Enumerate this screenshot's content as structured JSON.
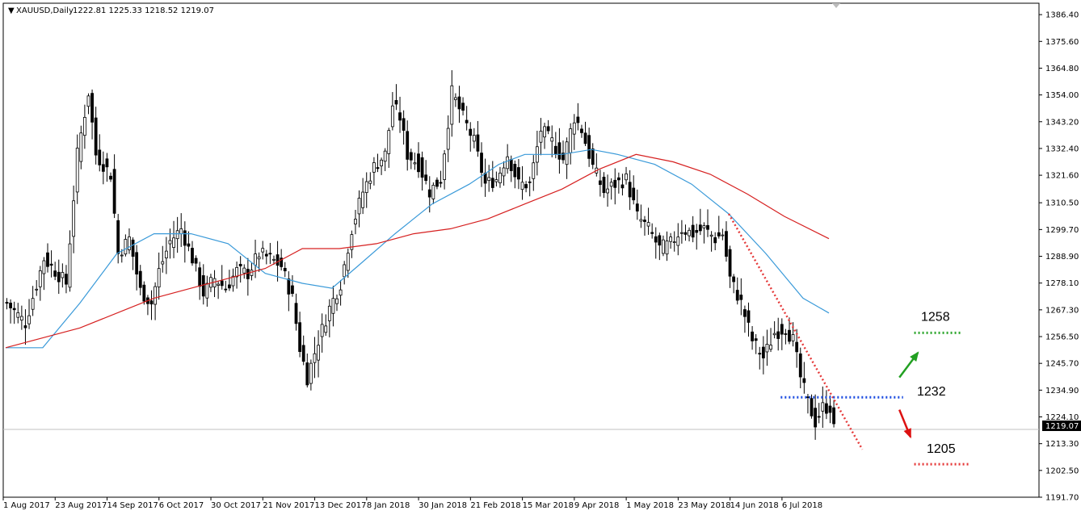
{
  "header": {
    "symbol": "XAUUSD,Daily",
    "ohlc": "1222.81 1225.33 1218.52 1219.07"
  },
  "current_price": "1219.07",
  "colors": {
    "ma_fast": "#3a9ad9",
    "ma_slow": "#d62020",
    "trendline": "#e53a3a",
    "level_upper": "#2ea62e",
    "level_pivot": "#1f4fe0",
    "level_lower": "#e53a3a",
    "arrow_up": "#22a022",
    "arrow_down": "#dd1111",
    "candle": "#000000"
  },
  "chart_data": {
    "type": "candlestick",
    "title": "XAUUSD,Daily",
    "ylim": [
      1191.7,
      1391.0
    ],
    "yticks": [
      "1386.40",
      "1375.60",
      "1364.80",
      "1354.00",
      "1343.20",
      "1332.40",
      "1321.60",
      "1310.50",
      "1299.70",
      "1288.90",
      "1278.10",
      "1267.30",
      "1256.50",
      "1245.70",
      "1234.90",
      "1224.10",
      "1213.30",
      "1202.50",
      "1191.70"
    ],
    "xticks": [
      "1 Aug 2017",
      "23 Aug 2017",
      "14 Sep 2017",
      "6 Oct 2017",
      "30 Oct 2017",
      "21 Nov 2017",
      "13 Dec 2017",
      "8 Jan 2018",
      "30 Jan 2018",
      "21 Feb 2018",
      "15 Mar 2018",
      "9 Apr 2018",
      "1 May 2018",
      "23 May 2018",
      "14 Jun 2018",
      "6 Jul 2018"
    ],
    "close_path": [
      [
        0,
        1270
      ],
      [
        5,
        1262
      ],
      [
        10,
        1288
      ],
      [
        16,
        1278
      ],
      [
        19,
        1330
      ],
      [
        22,
        1355
      ],
      [
        24,
        1330
      ],
      [
        28,
        1322
      ],
      [
        30,
        1290
      ],
      [
        33,
        1296
      ],
      [
        36,
        1275
      ],
      [
        39,
        1270
      ],
      [
        41,
        1283
      ],
      [
        44,
        1295
      ],
      [
        47,
        1300
      ],
      [
        50,
        1288
      ],
      [
        53,
        1274
      ],
      [
        56,
        1280
      ],
      [
        59,
        1276
      ],
      [
        62,
        1283
      ],
      [
        65,
        1282
      ],
      [
        68,
        1290
      ],
      [
        71,
        1288
      ],
      [
        74,
        1285
      ],
      [
        77,
        1272
      ],
      [
        79,
        1252
      ],
      [
        81,
        1240
      ],
      [
        84,
        1255
      ],
      [
        87,
        1268
      ],
      [
        90,
        1278
      ],
      [
        93,
        1300
      ],
      [
        96,
        1315
      ],
      [
        99,
        1325
      ],
      [
        102,
        1330
      ],
      [
        104,
        1350
      ],
      [
        106,
        1345
      ],
      [
        108,
        1330
      ],
      [
        111,
        1326
      ],
      [
        114,
        1315
      ],
      [
        117,
        1320
      ],
      [
        120,
        1355
      ],
      [
        123,
        1345
      ],
      [
        126,
        1335
      ],
      [
        129,
        1318
      ],
      [
        132,
        1320
      ],
      [
        135,
        1330
      ],
      [
        138,
        1318
      ],
      [
        141,
        1318
      ],
      [
        144,
        1340
      ],
      [
        147,
        1335
      ],
      [
        150,
        1328
      ],
      [
        153,
        1345
      ],
      [
        155,
        1340
      ],
      [
        158,
        1325
      ],
      [
        161,
        1315
      ],
      [
        164,
        1318
      ],
      [
        167,
        1320
      ],
      [
        170,
        1305
      ],
      [
        173,
        1300
      ],
      [
        176,
        1292
      ],
      [
        179,
        1294
      ],
      [
        182,
        1300
      ],
      [
        185,
        1298
      ],
      [
        188,
        1300
      ],
      [
        191,
        1296
      ],
      [
        193,
        1298
      ],
      [
        195,
        1280
      ],
      [
        198,
        1270
      ],
      [
        201,
        1255
      ],
      [
        204,
        1248
      ],
      [
        207,
        1258
      ],
      [
        210,
        1260
      ],
      [
        212,
        1255
      ],
      [
        214,
        1240
      ],
      [
        216,
        1230
      ],
      [
        218,
        1222
      ],
      [
        220,
        1228
      ],
      [
        222,
        1228
      ],
      [
        223,
        1219
      ]
    ],
    "series": [
      {
        "name": "",
        "type": "moving-average",
        "points": [
          [
            0,
            1252
          ],
          [
            10,
            1252
          ],
          [
            20,
            1270
          ],
          [
            30,
            1290
          ],
          [
            40,
            1298
          ],
          [
            50,
            1298
          ],
          [
            60,
            1294
          ],
          [
            70,
            1282
          ],
          [
            80,
            1278
          ],
          [
            88,
            1276
          ],
          [
            95,
            1285
          ],
          [
            105,
            1298
          ],
          [
            115,
            1310
          ],
          [
            125,
            1318
          ],
          [
            133,
            1326
          ],
          [
            140,
            1330
          ],
          [
            150,
            1330
          ],
          [
            158,
            1332
          ],
          [
            165,
            1330
          ],
          [
            175,
            1326
          ],
          [
            185,
            1318
          ],
          [
            195,
            1306
          ],
          [
            205,
            1290
          ],
          [
            215,
            1272
          ],
          [
            222,
            1266
          ]
        ]
      },
      {
        "name": "",
        "type": "moving-average",
        "points": [
          [
            0,
            1252
          ],
          [
            20,
            1260
          ],
          [
            40,
            1272
          ],
          [
            50,
            1276
          ],
          [
            60,
            1280
          ],
          [
            70,
            1284
          ],
          [
            80,
            1292
          ],
          [
            90,
            1292
          ],
          [
            100,
            1294
          ],
          [
            110,
            1298
          ],
          [
            120,
            1300
          ],
          [
            130,
            1304
          ],
          [
            140,
            1310
          ],
          [
            150,
            1316
          ],
          [
            160,
            1324
          ],
          [
            170,
            1330
          ],
          [
            180,
            1327
          ],
          [
            190,
            1322
          ],
          [
            200,
            1314
          ],
          [
            210,
            1305
          ],
          [
            222,
            1296
          ]
        ]
      }
    ],
    "annotations": [
      {
        "type": "trendline",
        "from": [
          195,
          1306
        ],
        "to": [
          231,
          1211
        ]
      },
      {
        "type": "level",
        "label": "1258",
        "value": 1258,
        "x_range": [
          245,
          258
        ]
      },
      {
        "type": "level",
        "label": "1232",
        "value": 1232,
        "x_range": [
          209,
          242
        ]
      },
      {
        "type": "level",
        "label": "1205",
        "value": 1205,
        "x_range": [
          245,
          260
        ]
      },
      {
        "type": "arrow",
        "direction": "up",
        "from": [
          241,
          1240
        ],
        "to": [
          246,
          1250
        ]
      },
      {
        "type": "arrow",
        "direction": "down",
        "from": [
          241,
          1227
        ],
        "to": [
          244,
          1216
        ]
      }
    ]
  }
}
